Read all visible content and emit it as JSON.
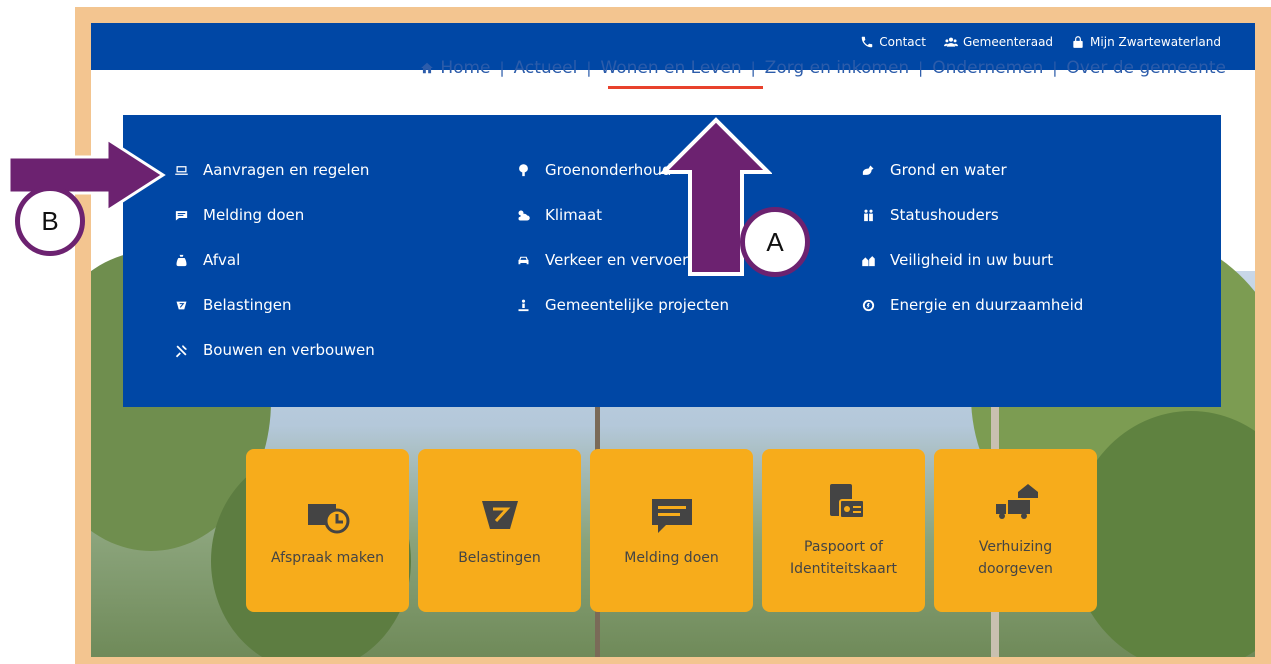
{
  "utility_nav": [
    {
      "label": "Contact",
      "icon": "phone-icon"
    },
    {
      "label": "Gemeenteraad",
      "icon": "people-icon"
    },
    {
      "label": "Mijn Zwartewaterland",
      "icon": "lock-icon"
    }
  ],
  "main_nav": {
    "items": [
      {
        "label": "Home",
        "icon": "home-icon"
      },
      {
        "label": "Actueel"
      },
      {
        "label": "Wonen en Leven",
        "active": true
      },
      {
        "label": "Zorg en inkomen"
      },
      {
        "label": "Ondernemen"
      },
      {
        "label": "Over de gemeente"
      }
    ],
    "separator": "|",
    "active_color": "#e8412c"
  },
  "dropdown": {
    "columns": [
      [
        {
          "label": "Aanvragen en regelen",
          "icon": "laptop-icon"
        },
        {
          "label": "Melding doen",
          "icon": "message-icon"
        },
        {
          "label": "Afval",
          "icon": "bag-icon"
        },
        {
          "label": "Belastingen",
          "icon": "tag-icon"
        },
        {
          "label": "Bouwen en verbouwen",
          "icon": "tools-icon"
        }
      ],
      [
        {
          "label": "Groenonderhoud",
          "icon": "tree-icon"
        },
        {
          "label": "Klimaat",
          "icon": "cloud-sun-icon"
        },
        {
          "label": "Verkeer en vervoer",
          "icon": "car-icon"
        },
        {
          "label": "Gemeentelijke projecten",
          "icon": "person-flag-icon"
        }
      ],
      [
        {
          "label": "Grond en water",
          "icon": "water-icon"
        },
        {
          "label": "Statushouders",
          "icon": "family-icon"
        },
        {
          "label": "Veiligheid in uw buurt",
          "icon": "neighborhood-icon"
        },
        {
          "label": "Energie en duurzaamheid",
          "icon": "energy-icon"
        }
      ]
    ]
  },
  "tiles": [
    {
      "label": "Afspraak maken",
      "icon": "calendar-clock-icon"
    },
    {
      "label": "Belastingen",
      "icon": "tag-icon"
    },
    {
      "label": "Melding doen",
      "icon": "chat-icon"
    },
    {
      "label": "Paspoort of Identiteitskaart",
      "icon": "id-card-icon"
    },
    {
      "label": "Verhuizing doorgeven",
      "icon": "moving-truck-icon"
    }
  ],
  "annotations": {
    "a_label": "A",
    "b_label": "B",
    "arrow_color": "#6c2270"
  },
  "colors": {
    "brand_blue": "#0047a5",
    "tile_orange": "#f7ac1b",
    "frame": "#f3c590"
  }
}
